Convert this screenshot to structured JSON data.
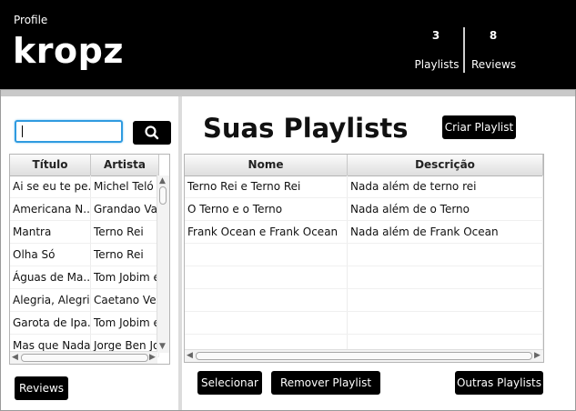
{
  "header": {
    "profile_caption": "Profile",
    "username": "kropz",
    "playlists_count": "3",
    "playlists_label": "Playlists",
    "reviews_count": "8",
    "reviews_label": "Reviews"
  },
  "search": {
    "value": "",
    "placeholder": ""
  },
  "songs_table": {
    "columns": [
      "Título",
      "Artista"
    ],
    "rows": [
      [
        "Ai se eu te pe...",
        "Michel Teló"
      ],
      [
        "Americana N...",
        "Grandao Vaq"
      ],
      [
        "Mantra",
        "Terno Rei"
      ],
      [
        "Olha Só",
        "Terno Rei"
      ],
      [
        "Águas de Ma...",
        "Tom Jobim e"
      ],
      [
        "Alegria, Alegria",
        "Caetano Vel..."
      ],
      [
        "Garota de Ipa...",
        "Tom Jobim e"
      ],
      [
        "Mas que Nada",
        "Jorge Ben Jor"
      ]
    ]
  },
  "main": {
    "heading": "Suas Playlists",
    "create_playlist_label": "Criar Playlist"
  },
  "playlists_table": {
    "columns": [
      "Nome",
      "Descrição"
    ],
    "rows": [
      [
        "Terno Rei e Terno Rei",
        "Nada além de terno rei"
      ],
      [
        "O Terno e o Terno",
        "Nada além de o Terno"
      ],
      [
        "Frank Ocean e Frank Ocean",
        "Nada além de Frank Ocean"
      ],
      [
        "",
        ""
      ],
      [
        "",
        ""
      ],
      [
        "",
        ""
      ],
      [
        "",
        ""
      ],
      [
        "",
        ""
      ]
    ]
  },
  "buttons": {
    "reviews": "Reviews",
    "select": "Selecionar",
    "remove_playlist": "Remover Playlist",
    "other_playlists": "Outras Playlists"
  },
  "icons": {
    "search": "search-icon"
  },
  "colors": {
    "header_bg": "#000000",
    "button_bg": "#000000",
    "focus_ring": "#2f9be0"
  }
}
